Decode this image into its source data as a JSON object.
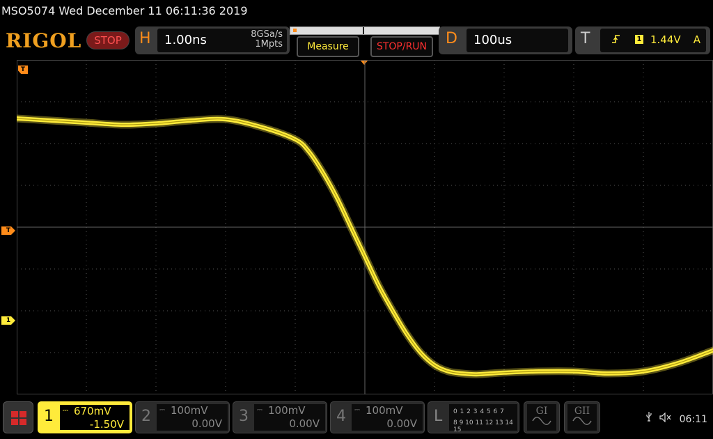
{
  "title_bar": {
    "text": "MSO5074  Wed December 11 06:11:36 2019"
  },
  "header": {
    "logo": "RIGOL",
    "run_state": "STOP",
    "horizontal": {
      "letter": "H",
      "timebase": "1.00ns",
      "sample_rate": "8GSa/s",
      "memory_depth": "1Mpts"
    },
    "measure_label": "Measure",
    "stop_run_label": "STOP/RUN",
    "delay": {
      "letter": "D",
      "value": "100us"
    },
    "trigger": {
      "letter": "T",
      "edge_icon": "rising-edge-icon",
      "source": "1",
      "level": "1.44V",
      "mode": "A"
    }
  },
  "markers": {
    "top_trigger": "T",
    "trigger_level": "T",
    "channel1": "1"
  },
  "channels": [
    {
      "number": "1",
      "coupling": "⎓",
      "scale": "670mV",
      "offset": "-1.50V",
      "active": true
    },
    {
      "number": "2",
      "coupling": "⎓",
      "scale": "100mV",
      "offset": "0.00V",
      "active": false
    },
    {
      "number": "3",
      "coupling": "⎓",
      "scale": "100mV",
      "offset": "0.00V",
      "active": false
    },
    {
      "number": "4",
      "coupling": "⎓",
      "scale": "100mV",
      "offset": "0.00V",
      "active": false
    }
  ],
  "logic": {
    "letter": "L",
    "row1": "0 1 2 3  4 5 6 7",
    "row2": "8 9 10 11 12 13 14 15"
  },
  "generators": [
    {
      "label": "GI"
    },
    {
      "label": "GII"
    }
  ],
  "status": {
    "usb_icon": "usb-icon",
    "speaker_icon": "speaker-muted-icon",
    "time": "06:11"
  },
  "colors": {
    "ch1": "#ffeb3b",
    "accent": "#ff8c1a",
    "grid": "#555555",
    "stop": "#ff3030"
  },
  "chart_data": {
    "type": "line",
    "grid": true,
    "divisions": {
      "x": 10,
      "y": 8
    },
    "series": [
      {
        "x": [
          0,
          0.5,
          1,
          1.5,
          2,
          2.5,
          3,
          3.5,
          4,
          4.2,
          4.4,
          4.6,
          4.8,
          5.0,
          5.2,
          5.4,
          5.6,
          5.8,
          6.0,
          6.2,
          6.4,
          6.6,
          6.8,
          7.0,
          7.5,
          8,
          8.5,
          9,
          9.5,
          10
        ],
        "y": [
          6.6,
          6.55,
          6.5,
          6.45,
          6.48,
          6.55,
          6.58,
          6.4,
          6.1,
          5.8,
          5.3,
          4.7,
          4.0,
          3.3,
          2.6,
          2.0,
          1.45,
          1.0,
          0.7,
          0.55,
          0.5,
          0.48,
          0.5,
          0.52,
          0.55,
          0.55,
          0.5,
          0.55,
          0.75,
          1.05
        ]
      }
    ]
  }
}
